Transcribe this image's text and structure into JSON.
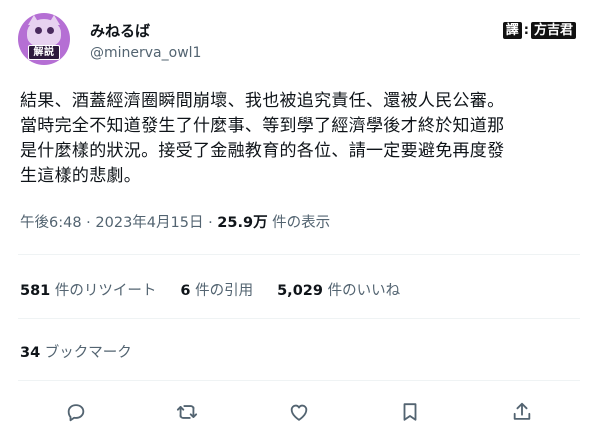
{
  "author": {
    "avatar_badge": "解説",
    "display_name": "みねるば",
    "handle": "@minerva_owl1"
  },
  "translator": {
    "label": "譯",
    "separator": ":",
    "name": "方吉君"
  },
  "tweet": {
    "text_lines": [
      "結果、酒蓋經濟圈瞬間崩壞、我也被追究責任、還被人民公審。",
      "當時完全不知道發生了什麼事、等到學了經濟學後才終於知道那",
      "是什麼樣的狀況。接受了金融教育的各位、請一定要避免再度發",
      "生這樣的悲劇。"
    ],
    "timestamp": "午後6:48 · 2023年4月15日 · ",
    "views_count": "25.9万",
    "views_label": " 件の表示"
  },
  "stats": {
    "retweets_count": "581",
    "retweets_label": " 件のリツイート",
    "quotes_count": "6",
    "quotes_label": " 件の引用",
    "likes_count": "5,029",
    "likes_label": " 件のいいね"
  },
  "bookmarks": {
    "count": "34",
    "label": " ブックマーク"
  },
  "actions": [
    "reply-icon",
    "retweet-icon",
    "like-icon",
    "bookmark-icon",
    "share-icon"
  ],
  "colors": {
    "text_primary": "#0f1419",
    "text_secondary": "#536471",
    "divider": "#eff3f4",
    "avatar_bg": "#b56fd4"
  }
}
